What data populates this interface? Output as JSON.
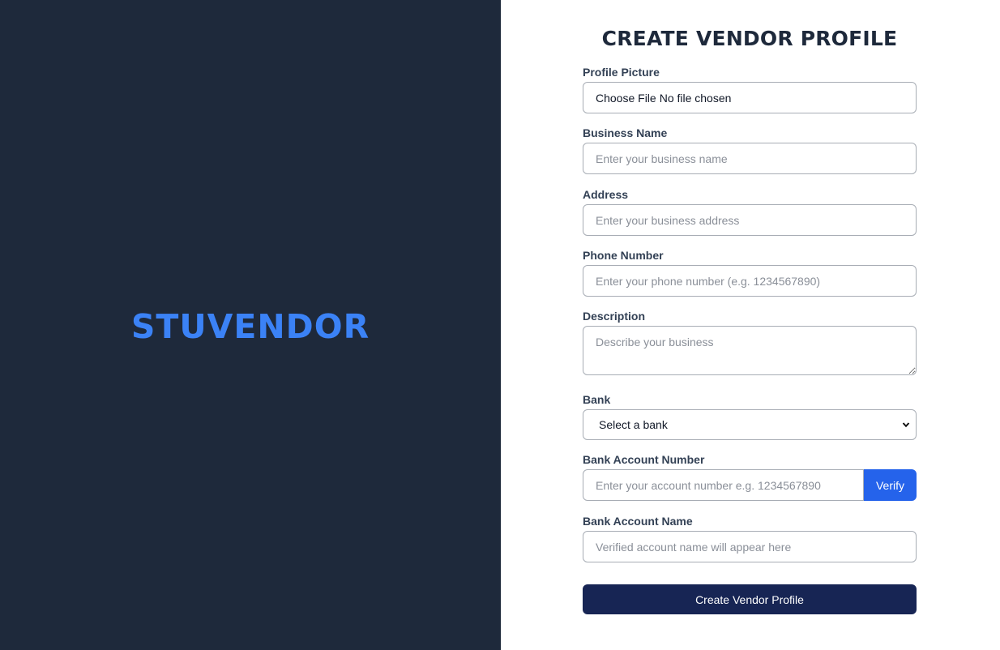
{
  "brand": {
    "name": "STUVENDOR"
  },
  "form": {
    "title": "CREATE VENDOR PROFILE",
    "profile_picture": {
      "label": "Profile Picture",
      "button": "Choose File",
      "status": "No file chosen"
    },
    "business_name": {
      "label": "Business Name",
      "placeholder": "Enter your business name"
    },
    "address": {
      "label": "Address",
      "placeholder": "Enter your business address"
    },
    "phone": {
      "label": "Phone Number",
      "placeholder": "Enter your phone number (e.g. 1234567890)"
    },
    "description": {
      "label": "Description",
      "placeholder": "Describe your business"
    },
    "bank": {
      "label": "Bank",
      "selected": "Select a bank"
    },
    "account_number": {
      "label": "Bank Account Number",
      "placeholder": "Enter your account number e.g. 1234567890",
      "verify_label": "Verify"
    },
    "account_name": {
      "label": "Bank Account Name",
      "placeholder": "Verified account name will appear here"
    },
    "submit_label": "Create Vendor Profile"
  },
  "colors": {
    "left_panel_bg": "#1e293b",
    "brand": "#3b82f6",
    "verify_button": "#2563eb",
    "submit_button": "#172554"
  }
}
